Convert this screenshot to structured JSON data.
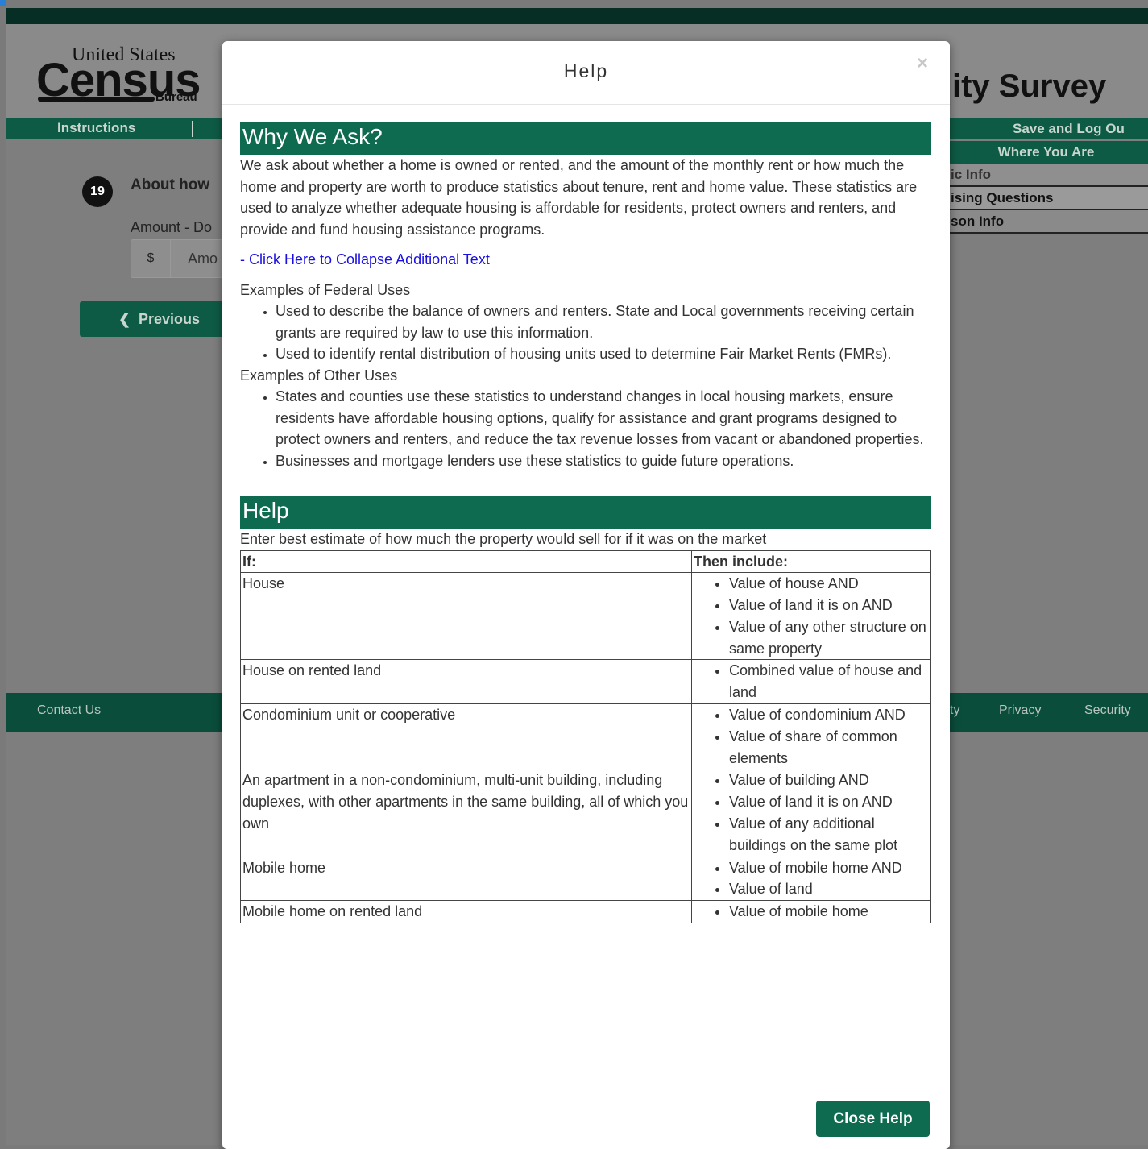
{
  "logo": {
    "united": "United States",
    "census": "Census",
    "bureau": "Bureau"
  },
  "header": {
    "title": "ity Survey"
  },
  "nav": {
    "instructions": "Instructions",
    "save": "Save and Log Ou"
  },
  "where_panel": {
    "heading": "Where You Are",
    "items": [
      "ic Info",
      "ising Questions",
      "son Info"
    ]
  },
  "question": {
    "number": "19",
    "text": "About how",
    "amount_label": "Amount - Do",
    "prefix": "$",
    "placeholder": "Amo"
  },
  "previous_button": {
    "chevron": "❮",
    "label": "Previous"
  },
  "footer": {
    "contact": "Contact Us",
    "partial": "ty",
    "privacy": "Privacy",
    "security": "Security"
  },
  "modal": {
    "title": "Help",
    "close_glyph": "×",
    "why_heading": "Why We Ask?",
    "why_text": "We ask about whether a home is owned or rented, and the amount of the monthly rent or how much the home and property are worth to produce statistics about tenure, rent and home value. These statistics are used to analyze whether adequate housing is affordable for residents, protect owners and renters, and provide and fund housing assistance programs.",
    "collapse_link": "- Click Here to Collapse Additional Text",
    "federal_heading": "Examples of Federal Uses",
    "federal_items": [
      "Used to describe the balance of owners and renters. State and Local governments receiving certain grants are required by law to use this information.",
      "Used to identify rental distribution of housing units used to determine Fair Market Rents (FMRs)."
    ],
    "other_heading": "Examples of Other Uses",
    "other_items": [
      "States and counties use these statistics to understand changes in local housing markets, ensure residents have affordable housing options, qualify for assistance and grant programs designed to protect owners and renters, and reduce the tax revenue losses from vacant or abandoned properties.",
      "Businesses and mortgage lenders use these statistics to guide future operations."
    ],
    "help_heading": "Help",
    "help_intro": "Enter best estimate of how much the property would sell for if it was on the market",
    "table": {
      "headers": [
        "If:",
        "Then include:"
      ],
      "rows": [
        {
          "if": "House",
          "then": [
            "Value of house AND",
            "Value of land it is on AND",
            "Value of any other structure on same property"
          ]
        },
        {
          "if": "House on rented land",
          "then": [
            "Combined value of house and land"
          ]
        },
        {
          "if": "Condominium unit or cooperative",
          "then": [
            "Value of condominium AND",
            "Value of share of common elements"
          ]
        },
        {
          "if": "An apartment in a non-condominium, multi-unit building, including duplexes, with other apartments in the same building, all of which you own",
          "then": [
            "Value of building AND",
            "Value of land it is on AND",
            "Value of any additional buildings on the same plot"
          ]
        },
        {
          "if": "Mobile home",
          "then": [
            "Value of mobile home AND",
            "Value of land"
          ]
        },
        {
          "if": "Mobile home on rented land",
          "then": [
            "Value of mobile home"
          ]
        }
      ]
    },
    "close_button": "Close Help"
  }
}
